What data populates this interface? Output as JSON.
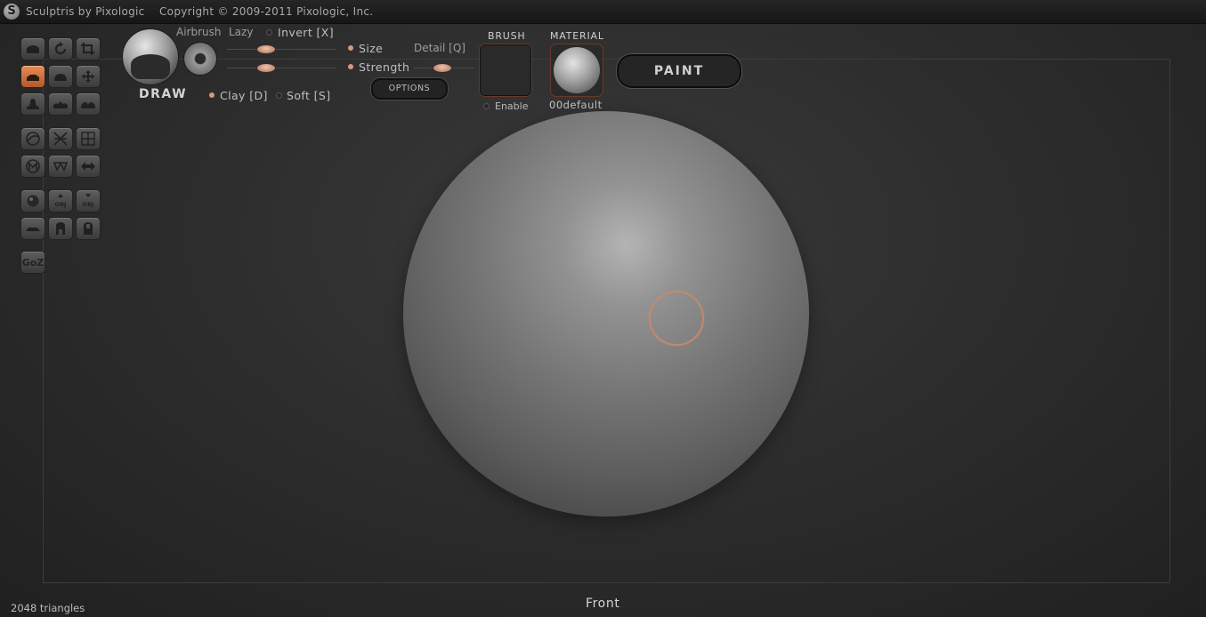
{
  "titlebar": {
    "title": "Sculptris by Pixologic    Copyright © 2009-2011 Pixologic, Inc."
  },
  "tools": {
    "rows": [
      [
        "draw-tool-icon",
        "rotate-tool-icon",
        "crop-tool-icon"
      ],
      [
        "flatten-tool-icon",
        "inflate-tool-icon",
        "grab-tool-icon"
      ],
      [
        "pinch-tool-icon",
        "smooth-tool-icon",
        "crease-tool-icon"
      ],
      [
        "symmetry-icon",
        "wireframe-icon",
        "grid-icon"
      ],
      [
        "mask-icon",
        "reduce-icon",
        "mirror-icon"
      ],
      [
        "sphere-new-icon",
        "import-obj-icon",
        "export-obj-icon"
      ],
      [
        "plane-icon",
        "open-file-icon",
        "save-file-icon"
      ]
    ],
    "goz_label": "GoZ",
    "active_tool": "flatten"
  },
  "brush_panel": {
    "tool_name": "DRAW",
    "airbrush_label": "Airbrush",
    "lazy_label": "Lazy",
    "invert_label": "Invert [X]",
    "size_label": "Size",
    "strength_label": "Strength",
    "detail_label": "Detail [Q]",
    "clay_label": "Clay [D]",
    "soft_label": "Soft [S]",
    "options_label": "OPTIONS",
    "lazy_value": 0.35,
    "size_value": 0.5,
    "strength_value": 0.35,
    "detail_value": 0.45,
    "invert_enabled": false,
    "clay_enabled": true,
    "soft_enabled": false
  },
  "brush_texture": {
    "header": "BRUSH",
    "enable_label": "Enable",
    "enabled": false
  },
  "material": {
    "header": "MATERIAL",
    "name": "00default"
  },
  "paint_button": {
    "label": "PAINT"
  },
  "status": {
    "triangles": "2048 triangles",
    "view": "Front"
  },
  "colors": {
    "accent": "#d47a45",
    "background": "#2c2c2c",
    "cursor": "#c08a6c"
  }
}
